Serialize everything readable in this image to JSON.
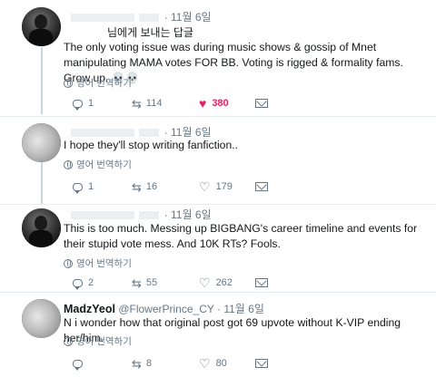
{
  "tweets": [
    {
      "timestamp": "· 11월 6일",
      "reply_to": "님에게 보내는 답글",
      "text": "The only voting issue was during music shows & gossip of Mnet manipulating MAMA votes FOR BB. Voting is rigged & formality fams. Grow up. 💀💀",
      "translate": "영어 번역하기",
      "replies": "1",
      "retweets": "114",
      "likes": "380",
      "liked": true,
      "like_color": "#e0245e"
    },
    {
      "timestamp": "· 11월 6일",
      "text": "I hope they'll stop writing fanfiction..",
      "translate": "영어 번역하기",
      "replies": "1",
      "retweets": "16",
      "likes": "179"
    },
    {
      "timestamp": "· 11월 6일",
      "text": "This is too much. Messing up BIGBANG's career timeline and events for their stupid vote mess. And 10K RTs? Fools.",
      "translate": "영어 번역하기",
      "replies": "2",
      "retweets": "55",
      "likes": "262"
    },
    {
      "name": "MadzYeol",
      "handle": "@FlowerPrince_CY",
      "timestamp": "· 11월 6일",
      "text": "N i wonder how that original post got 69 upvote without K-VIP ending her/him.",
      "translate": "영어 번역하기",
      "replies": "",
      "retweets": "8",
      "likes": "80"
    }
  ],
  "icons": [
    "reply-icon",
    "retweet-icon",
    "like-icon",
    "direct-message-icon",
    "globe-icon"
  ],
  "colors": {
    "accent_like": "#e0245e",
    "muted": "#657786",
    "text": "#14171a",
    "thread_line": "#ccd6dd"
  }
}
